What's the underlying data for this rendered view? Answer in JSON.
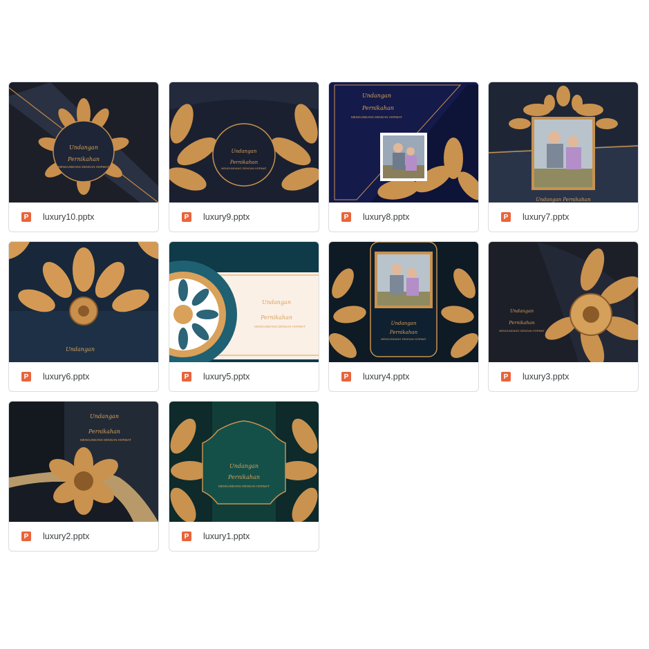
{
  "files": [
    {
      "name": "luxury10.pptx",
      "icon": "powerpoint-icon",
      "icon_letter": "P",
      "title1": "Undangan",
      "title2": "Pernikahan",
      "subtitle": "MENGUNDANG DENGAN HORMAT"
    },
    {
      "name": "luxury9.pptx",
      "icon": "powerpoint-icon",
      "icon_letter": "P",
      "title1": "Undangan",
      "title2": "Pernikahan",
      "subtitle": "MENGUNDANG DENGAN HORMAT"
    },
    {
      "name": "luxury8.pptx",
      "icon": "powerpoint-icon",
      "icon_letter": "P",
      "title1": "Undangan",
      "title2": "Pernikahan",
      "subtitle": "MENGUNDANG DENGAN HORMAT"
    },
    {
      "name": "luxury7.pptx",
      "icon": "powerpoint-icon",
      "icon_letter": "P",
      "title1": "Undangan Pernikahan"
    },
    {
      "name": "luxury6.pptx",
      "icon": "powerpoint-icon",
      "icon_letter": "P",
      "title1": "Undangan"
    },
    {
      "name": "luxury5.pptx",
      "icon": "powerpoint-icon",
      "icon_letter": "P",
      "title1": "Undangan",
      "title2": "Pernikahan",
      "subtitle": "MENGUNDANG DENGAN HORMAT"
    },
    {
      "name": "luxury4.pptx",
      "icon": "powerpoint-icon",
      "icon_letter": "P",
      "title1": "Undangan",
      "title2": "Pernikahan",
      "subtitle": "MENGUNDANG DENGAN HORMAT"
    },
    {
      "name": "luxury3.pptx",
      "icon": "powerpoint-icon",
      "icon_letter": "P",
      "title1": "Undangan",
      "title2": "Pernikahan",
      "subtitle": "MENGUNDANG DENGAN HORMAT"
    },
    {
      "name": "luxury2.pptx",
      "icon": "powerpoint-icon",
      "icon_letter": "P",
      "title1": "Undangan",
      "title2": "Pernikahan",
      "subtitle": "MENGUNDANG DENGAN HORMAT"
    },
    {
      "name": "luxury1.pptx",
      "icon": "powerpoint-icon",
      "icon_letter": "P",
      "title1": "Undangan",
      "title2": "Pernikahan",
      "subtitle": "MENGUNDANG DENGAN HORMAT"
    }
  ],
  "colors": {
    "gold": "#d9a15a",
    "navy": "#1a2234",
    "teal": "#0f4a45",
    "powerpoint": "#e8643b"
  }
}
